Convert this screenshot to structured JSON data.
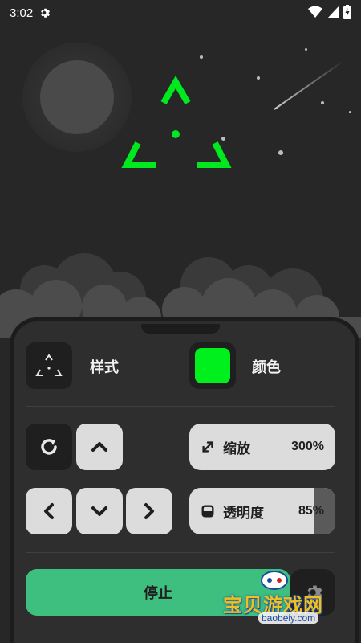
{
  "status_bar": {
    "time": "3:02"
  },
  "controls": {
    "style_label": "样式",
    "color_label": "颜色",
    "selected_color": "#00f01e",
    "zoom": {
      "label": "缩放",
      "value": "300%"
    },
    "opacity": {
      "label": "透明度",
      "value": "85%",
      "level": 0.85
    },
    "stop_label": "停止"
  },
  "crosshair_color": "#00e81e",
  "watermark": {
    "brand": "宝贝游戏网",
    "url": "baobeiy.com"
  }
}
